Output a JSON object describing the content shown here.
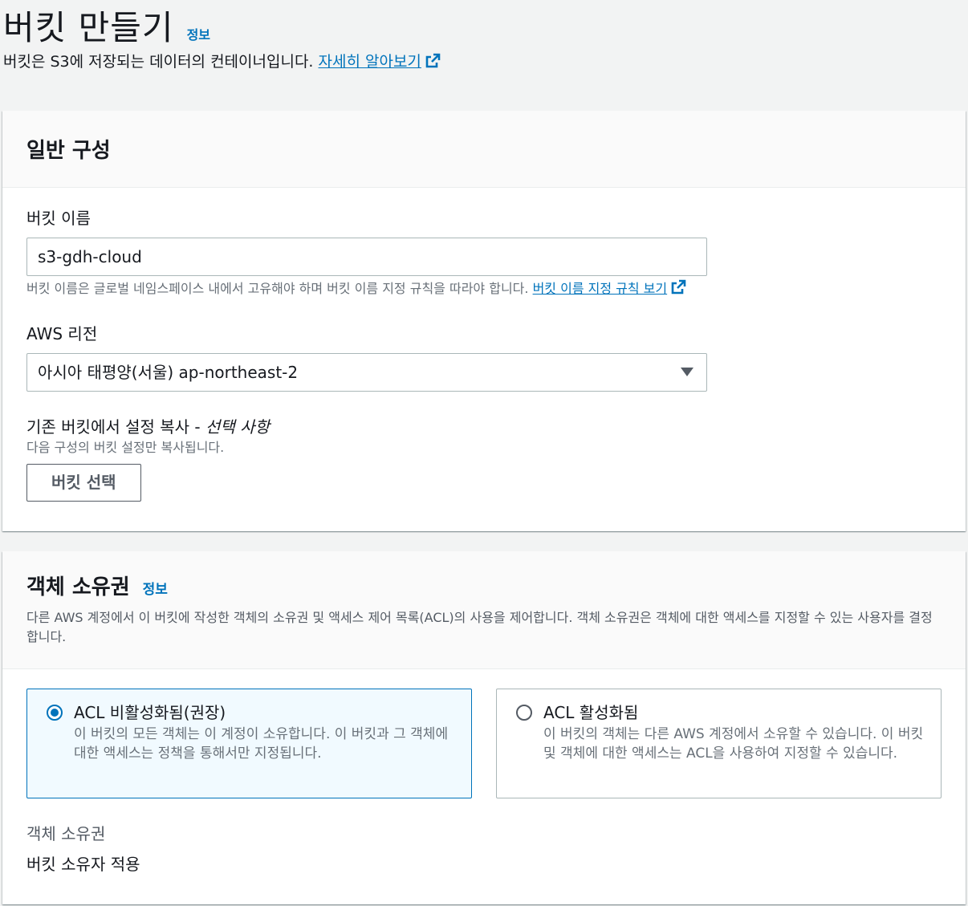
{
  "header": {
    "title": "버킷 만들기",
    "info": "정보",
    "description": "버킷은 S3에 저장되는 데이터의 컨테이너입니다.",
    "learn_more": "자세히 알아보기"
  },
  "general": {
    "title": "일반 구성",
    "bucket_name_label": "버킷 이름",
    "bucket_name_value": "s3-gdh-cloud",
    "bucket_name_hint": "버킷 이름은 글로벌 네임스페이스 내에서 고유해야 하며 버킷 이름 지정 규칙을 따라야 합니다.",
    "bucket_name_rules_link": "버킷 이름 지정 규칙 보기",
    "region_label": "AWS 리전",
    "region_value": "아시아 태평양(서울) ap-northeast-2",
    "copy_label": "기존 버킷에서 설정 복사 - ",
    "copy_optional": "선택 사항",
    "copy_hint": "다음 구성의 버킷 설정만 복사됩니다.",
    "choose_bucket_button": "버킷 선택"
  },
  "ownership": {
    "title": "객체 소유권",
    "info": "정보",
    "description": "다른 AWS 계정에서 이 버킷에 작성한 객체의 소유권 및 액세스 제어 목록(ACL)의 사용을 제어합니다. 객체 소유권은 객체에 대한 액세스를 지정할 수 있는 사용자를 결정합니다.",
    "options": [
      {
        "label": "ACL 비활성화됨(권장)",
        "description": "이 버킷의 모든 객체는 이 계정이 소유합니다. 이 버킷과 그 객체에 대한 액세스는 정책을 통해서만 지정됩니다.",
        "selected": true
      },
      {
        "label": "ACL 활성화됨",
        "description": "이 버킷의 객체는 다른 AWS 계정에서 소유할 수 있습니다. 이 버킷 및 객체에 대한 액세스는 ACL을 사용하여 지정할 수 있습니다.",
        "selected": false
      }
    ],
    "ownership_key": "객체 소유권",
    "ownership_value": "버킷 소유자 적용"
  },
  "colors": {
    "link": "#0073bb",
    "background": "#f2f3f3",
    "selected_tile_bg": "#f1faff"
  }
}
